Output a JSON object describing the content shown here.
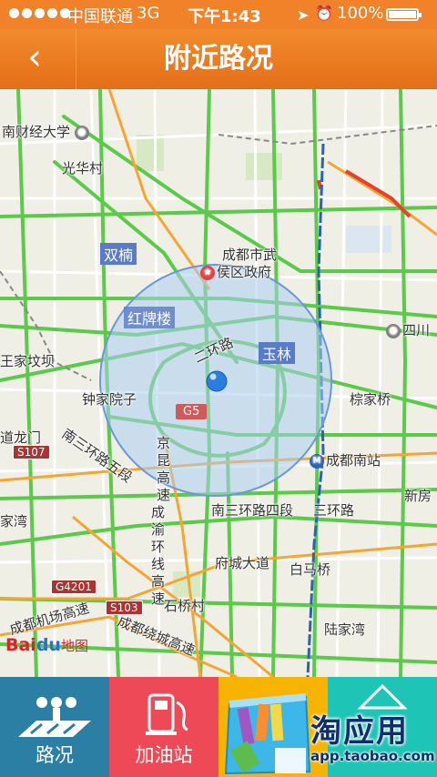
{
  "status_bar": {
    "carrier": "中国联通",
    "network": "3G",
    "time": "下午1:43",
    "battery": "100%"
  },
  "nav": {
    "back_icon": "chevron-left-icon",
    "title": "附近路况"
  },
  "map": {
    "labels": {
      "nancai": "南财经大学",
      "guanghuacun": "光华村",
      "shuangnan": "双楠",
      "chengdushiwu_1": "成都市武",
      "chengdushiwu_2": "侯区政府",
      "hongpailou": "红牌楼",
      "yulin": "玉林",
      "sichuan": "四川",
      "wangjiagongba": "王家坟坝",
      "zhongjiayuanzi": "钟家院子",
      "erhuanlu": "二环路",
      "zongjiaqiao": "棕家桥",
      "daolongmen": "道龙门",
      "nansanhuan5": "南三环路五段",
      "chengdunanzhan": "成都南站",
      "jingkun_gaosu": "京昆高速",
      "xinfang": "新房",
      "jiawan": "家湾",
      "nansanhuan4": "南三环路四段",
      "sanhuanlu": "三环路",
      "chengyu_huanxian": "成渝环线高速",
      "fuchengdadao": "府城大道",
      "baimaqiao": "白马桥",
      "shiqiaocun": "石桥村",
      "lujiawan": "陆家湾",
      "jichang_gaosu": "成都机场高速",
      "raocheng_gaosu": "成都绕城高速"
    },
    "shields": {
      "s107": "S107",
      "g5": "G5",
      "g4201": "G4201",
      "s103": "S103"
    },
    "logo": {
      "bai": "Bai",
      "du": "du",
      "map": "地图"
    }
  },
  "tabs": {
    "road": "路况",
    "gas": "加油站",
    "app_icon": "shopping-bag-icon",
    "cam_icon": "camera-icon"
  },
  "badge": {
    "title": "淘应用",
    "url": "app.taobao.com"
  }
}
